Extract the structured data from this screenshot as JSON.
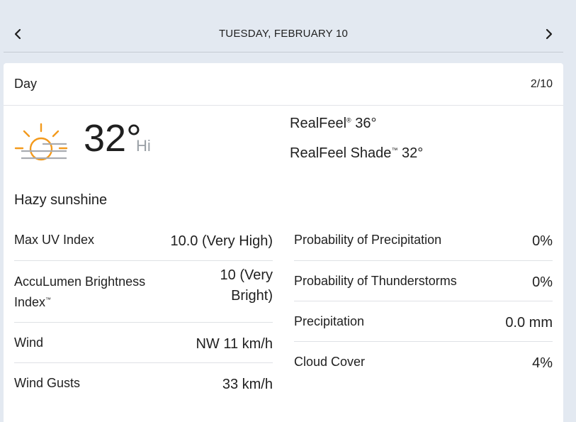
{
  "date_nav": {
    "date_label": "TUESDAY, FEBRUARY 10",
    "prev_icon": "chevron-left-icon",
    "next_icon": "chevron-right-icon"
  },
  "card": {
    "title": "Day",
    "date_short": "2/10",
    "icon": "hazy-sunshine-icon",
    "temperature": "32°",
    "temp_suffix": "Hi",
    "realfeel_label": "RealFeel",
    "realfeel_mark": "®",
    "realfeel_value": "36°",
    "realfeel_shade_label": "RealFeel Shade",
    "realfeel_shade_mark": "™",
    "realfeel_shade_value": "32°",
    "phrase": "Hazy sunshine"
  },
  "details_left": [
    {
      "label": "Max UV Index",
      "value": "10.0 (Very High)"
    },
    {
      "label": "AccuLumen Brightness Index",
      "mark": "™",
      "value": "10 (Very Bright)"
    },
    {
      "label": "Wind",
      "value": "NW 11 km/h"
    },
    {
      "label": "Wind Gusts",
      "value": "33 km/h"
    }
  ],
  "details_right": [
    {
      "label": "Probability of Precipitation",
      "value": "0%"
    },
    {
      "label": "Probability of Thunderstorms",
      "value": "0%"
    },
    {
      "label": "Precipitation",
      "value": "0.0 mm"
    },
    {
      "label": "Cloud Cover",
      "value": "4%"
    }
  ],
  "colors": {
    "page_background": "#e3e9f1",
    "card_background": "#ffffff",
    "sun_orange": "#f39a1d",
    "haze_gray": "#a9acb1",
    "muted_text": "#9aa0a6"
  }
}
